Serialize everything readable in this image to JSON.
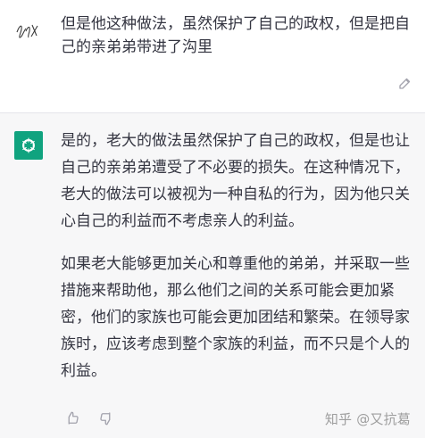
{
  "conversation": {
    "user_message": "但是他这种做法，虽然保护了自己的政权，但是把自己的亲弟弟带进了沟里",
    "assistant_paragraphs": [
      "是的，老大的做法虽然保护了自己的政权，但是也让自己的亲弟弟遭受了不必要的损失。在这种情况下，老大的做法可以被视为一种自私的行为，因为他只关心自己的利益而不考虑亲人的利益。",
      "如果老大能够更加关心和尊重他的弟弟，并采取一些措施来帮助他，那么他们之间的关系可能会更加紧密，他们的家族也可能会更加团结和繁荣。在领导家族时，应该考虑到整个家族的利益，而不只是个人的利益。"
    ]
  },
  "icons": {
    "user_avatar": "signature-avatar-icon",
    "edit": "edit-icon",
    "assistant_avatar": "openai-logo-icon",
    "thumbs_up": "thumbs-up-icon",
    "thumbs_down": "thumbs-down-icon"
  },
  "watermark": {
    "text": "知乎 @又抗葛"
  },
  "colors": {
    "assistant_background": "#f7f7f8",
    "avatar_green": "#10a37f",
    "text": "#343541",
    "muted": "#8e8ea0"
  }
}
